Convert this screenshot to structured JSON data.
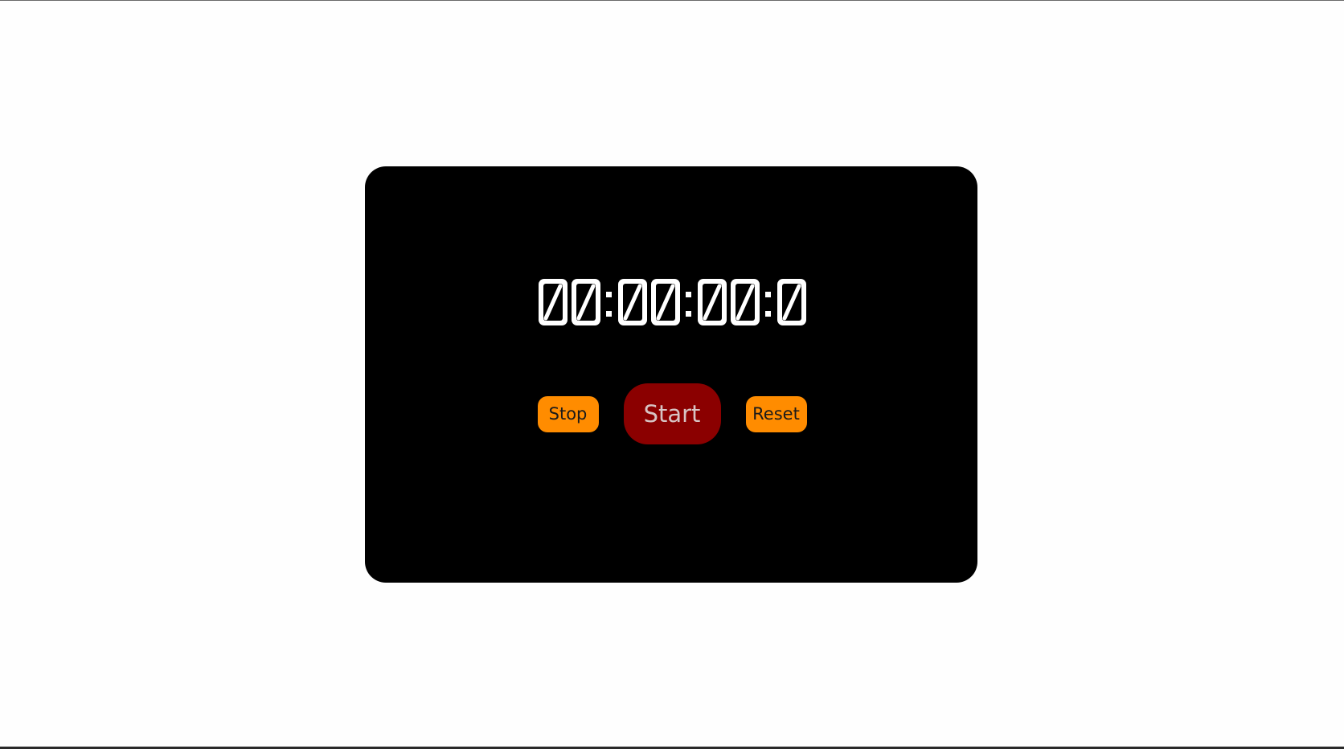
{
  "display": {
    "time": "00:00:00:00",
    "digit_color": "#ffffff"
  },
  "controls": {
    "stop_label": "Stop",
    "start_label": "Start",
    "reset_label": "Reset"
  },
  "colors": {
    "panel": "#000000",
    "page_background": "#fefefe",
    "side_button": "#ff8c00",
    "start_button": "#8b0000",
    "start_text": "#d7c4c4"
  }
}
